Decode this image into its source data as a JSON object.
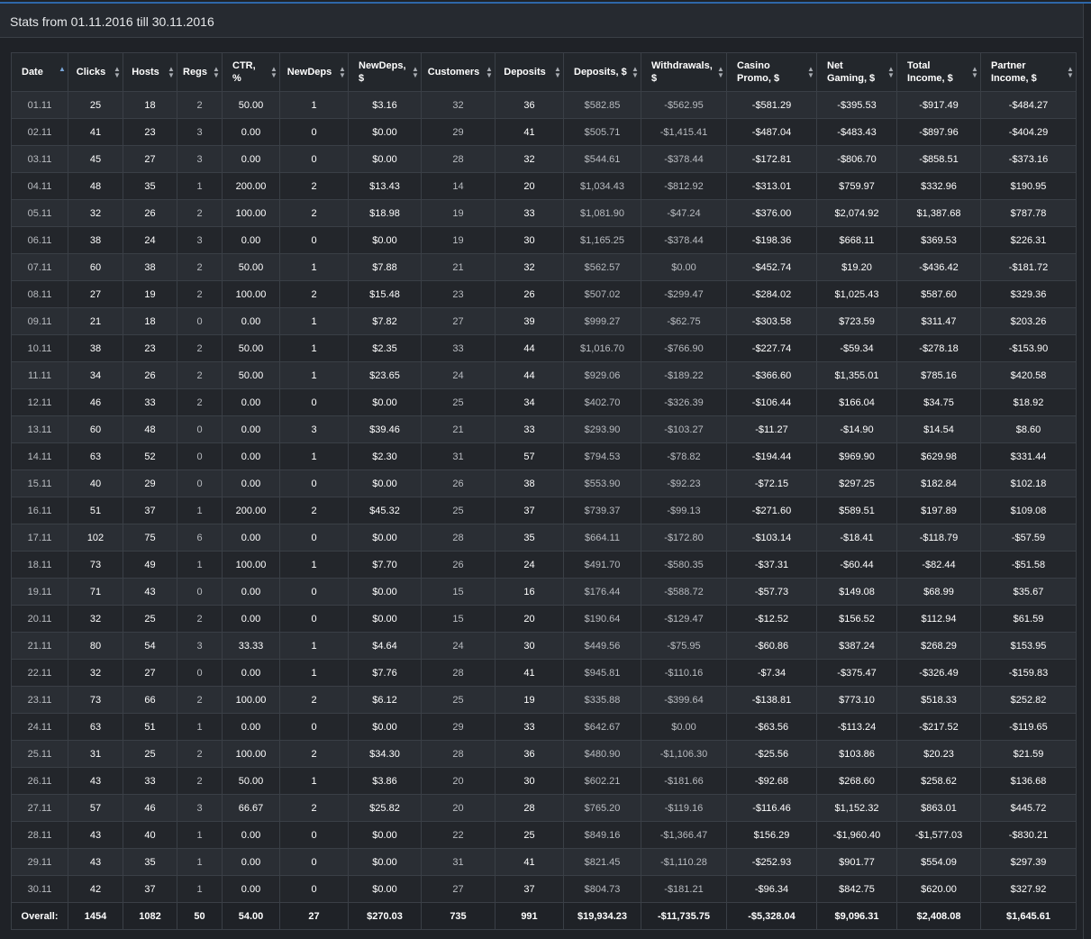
{
  "header": {
    "title": "Stats from 01.11.2016 till 30.11.2016"
  },
  "table": {
    "columns": [
      {
        "label": "Date",
        "align": "left",
        "sort": "asc"
      },
      {
        "label": "Clicks",
        "align": "center",
        "sort": "none"
      },
      {
        "label": "Hosts",
        "align": "center",
        "sort": "none"
      },
      {
        "label": "Regs",
        "align": "center",
        "sort": "none"
      },
      {
        "label": "CTR, %",
        "align": "left",
        "sort": "none"
      },
      {
        "label": "NewDeps",
        "align": "center",
        "sort": "none"
      },
      {
        "label": "NewDeps, $",
        "align": "left",
        "sort": "none"
      },
      {
        "label": "Customers",
        "align": "center",
        "sort": "none"
      },
      {
        "label": "Deposits",
        "align": "center",
        "sort": "none"
      },
      {
        "label": "Deposits, $",
        "align": "left",
        "sort": "none"
      },
      {
        "label": "Withdrawals, $",
        "align": "left",
        "sort": "none"
      },
      {
        "label": "Casino Promo, $",
        "align": "left",
        "sort": "none"
      },
      {
        "label": "Net Gaming, $",
        "align": "left",
        "sort": "none"
      },
      {
        "label": "Total Income, $",
        "align": "left",
        "sort": "none"
      },
      {
        "label": "Partner Income, $",
        "align": "left",
        "sort": "none"
      }
    ],
    "rows": [
      [
        "01.11",
        "25",
        "18",
        "2",
        "50.00",
        "1",
        "$3.16",
        "32",
        "36",
        "$582.85",
        "-$562.95",
        "-$581.29",
        "-$395.53",
        "-$917.49",
        "-$484.27"
      ],
      [
        "02.11",
        "41",
        "23",
        "3",
        "0.00",
        "0",
        "$0.00",
        "29",
        "41",
        "$505.71",
        "-$1,415.41",
        "-$487.04",
        "-$483.43",
        "-$897.96",
        "-$404.29"
      ],
      [
        "03.11",
        "45",
        "27",
        "3",
        "0.00",
        "0",
        "$0.00",
        "28",
        "32",
        "$544.61",
        "-$378.44",
        "-$172.81",
        "-$806.70",
        "-$858.51",
        "-$373.16"
      ],
      [
        "04.11",
        "48",
        "35",
        "1",
        "200.00",
        "2",
        "$13.43",
        "14",
        "20",
        "$1,034.43",
        "-$812.92",
        "-$313.01",
        "$759.97",
        "$332.96",
        "$190.95"
      ],
      [
        "05.11",
        "32",
        "26",
        "2",
        "100.00",
        "2",
        "$18.98",
        "19",
        "33",
        "$1,081.90",
        "-$47.24",
        "-$376.00",
        "$2,074.92",
        "$1,387.68",
        "$787.78"
      ],
      [
        "06.11",
        "38",
        "24",
        "3",
        "0.00",
        "0",
        "$0.00",
        "19",
        "30",
        "$1,165.25",
        "-$378.44",
        "-$198.36",
        "$668.11",
        "$369.53",
        "$226.31"
      ],
      [
        "07.11",
        "60",
        "38",
        "2",
        "50.00",
        "1",
        "$7.88",
        "21",
        "32",
        "$562.57",
        "$0.00",
        "-$452.74",
        "$19.20",
        "-$436.42",
        "-$181.72"
      ],
      [
        "08.11",
        "27",
        "19",
        "2",
        "100.00",
        "2",
        "$15.48",
        "23",
        "26",
        "$507.02",
        "-$299.47",
        "-$284.02",
        "$1,025.43",
        "$587.60",
        "$329.36"
      ],
      [
        "09.11",
        "21",
        "18",
        "0",
        "0.00",
        "1",
        "$7.82",
        "27",
        "39",
        "$999.27",
        "-$62.75",
        "-$303.58",
        "$723.59",
        "$311.47",
        "$203.26"
      ],
      [
        "10.11",
        "38",
        "23",
        "2",
        "50.00",
        "1",
        "$2.35",
        "33",
        "44",
        "$1,016.70",
        "-$766.90",
        "-$227.74",
        "-$59.34",
        "-$278.18",
        "-$153.90"
      ],
      [
        "11.11",
        "34",
        "26",
        "2",
        "50.00",
        "1",
        "$23.65",
        "24",
        "44",
        "$929.06",
        "-$189.22",
        "-$366.60",
        "$1,355.01",
        "$785.16",
        "$420.58"
      ],
      [
        "12.11",
        "46",
        "33",
        "2",
        "0.00",
        "0",
        "$0.00",
        "25",
        "34",
        "$402.70",
        "-$326.39",
        "-$106.44",
        "$166.04",
        "$34.75",
        "$18.92"
      ],
      [
        "13.11",
        "60",
        "48",
        "0",
        "0.00",
        "3",
        "$39.46",
        "21",
        "33",
        "$293.90",
        "-$103.27",
        "-$11.27",
        "-$14.90",
        "$14.54",
        "$8.60"
      ],
      [
        "14.11",
        "63",
        "52",
        "0",
        "0.00",
        "1",
        "$2.30",
        "31",
        "57",
        "$794.53",
        "-$78.82",
        "-$194.44",
        "$969.90",
        "$629.98",
        "$331.44"
      ],
      [
        "15.11",
        "40",
        "29",
        "0",
        "0.00",
        "0",
        "$0.00",
        "26",
        "38",
        "$553.90",
        "-$92.23",
        "-$72.15",
        "$297.25",
        "$182.84",
        "$102.18"
      ],
      [
        "16.11",
        "51",
        "37",
        "1",
        "200.00",
        "2",
        "$45.32",
        "25",
        "37",
        "$739.37",
        "-$99.13",
        "-$271.60",
        "$589.51",
        "$197.89",
        "$109.08"
      ],
      [
        "17.11",
        "102",
        "75",
        "6",
        "0.00",
        "0",
        "$0.00",
        "28",
        "35",
        "$664.11",
        "-$172.80",
        "-$103.14",
        "-$18.41",
        "-$118.79",
        "-$57.59"
      ],
      [
        "18.11",
        "73",
        "49",
        "1",
        "100.00",
        "1",
        "$7.70",
        "26",
        "24",
        "$491.70",
        "-$580.35",
        "-$37.31",
        "-$60.44",
        "-$82.44",
        "-$51.58"
      ],
      [
        "19.11",
        "71",
        "43",
        "0",
        "0.00",
        "0",
        "$0.00",
        "15",
        "16",
        "$176.44",
        "-$588.72",
        "-$57.73",
        "$149.08",
        "$68.99",
        "$35.67"
      ],
      [
        "20.11",
        "32",
        "25",
        "2",
        "0.00",
        "0",
        "$0.00",
        "15",
        "20",
        "$190.64",
        "-$129.47",
        "-$12.52",
        "$156.52",
        "$112.94",
        "$61.59"
      ],
      [
        "21.11",
        "80",
        "54",
        "3",
        "33.33",
        "1",
        "$4.64",
        "24",
        "30",
        "$449.56",
        "-$75.95",
        "-$60.86",
        "$387.24",
        "$268.29",
        "$153.95"
      ],
      [
        "22.11",
        "32",
        "27",
        "0",
        "0.00",
        "1",
        "$7.76",
        "28",
        "41",
        "$945.81",
        "-$110.16",
        "-$7.34",
        "-$375.47",
        "-$326.49",
        "-$159.83"
      ],
      [
        "23.11",
        "73",
        "66",
        "2",
        "100.00",
        "2",
        "$6.12",
        "25",
        "19",
        "$335.88",
        "-$399.64",
        "-$138.81",
        "$773.10",
        "$518.33",
        "$252.82"
      ],
      [
        "24.11",
        "63",
        "51",
        "1",
        "0.00",
        "0",
        "$0.00",
        "29",
        "33",
        "$642.67",
        "$0.00",
        "-$63.56",
        "-$113.24",
        "-$217.52",
        "-$119.65"
      ],
      [
        "25.11",
        "31",
        "25",
        "2",
        "100.00",
        "2",
        "$34.30",
        "28",
        "36",
        "$480.90",
        "-$1,106.30",
        "-$25.56",
        "$103.86",
        "$20.23",
        "$21.59"
      ],
      [
        "26.11",
        "43",
        "33",
        "2",
        "50.00",
        "1",
        "$3.86",
        "20",
        "30",
        "$602.21",
        "-$181.66",
        "-$92.68",
        "$268.60",
        "$258.62",
        "$136.68"
      ],
      [
        "27.11",
        "57",
        "46",
        "3",
        "66.67",
        "2",
        "$25.82",
        "20",
        "28",
        "$765.20",
        "-$119.16",
        "-$116.46",
        "$1,152.32",
        "$863.01",
        "$445.72"
      ],
      [
        "28.11",
        "43",
        "40",
        "1",
        "0.00",
        "0",
        "$0.00",
        "22",
        "25",
        "$849.16",
        "-$1,366.47",
        "$156.29",
        "-$1,960.40",
        "-$1,577.03",
        "-$830.21"
      ],
      [
        "29.11",
        "43",
        "35",
        "1",
        "0.00",
        "0",
        "$0.00",
        "31",
        "41",
        "$821.45",
        "-$1,110.28",
        "-$252.93",
        "$901.77",
        "$554.09",
        "$297.39"
      ],
      [
        "30.11",
        "42",
        "37",
        "1",
        "0.00",
        "0",
        "$0.00",
        "27",
        "37",
        "$804.73",
        "-$181.21",
        "-$96.34",
        "$842.75",
        "$620.00",
        "$327.92"
      ]
    ],
    "totals": [
      "Overall:",
      "1454",
      "1082",
      "50",
      "54.00",
      "27",
      "$270.03",
      "735",
      "991",
      "$19,934.23",
      "-$11,735.75",
      "-$5,328.04",
      "$9,096.31",
      "$2,408.08",
      "$1,645.61"
    ],
    "column_styles": [
      "dim",
      "em",
      "em",
      "dim",
      "em",
      "em",
      "em",
      "dim",
      "em",
      "dim",
      "dim",
      "em",
      "em",
      "em",
      "em"
    ]
  },
  "colors": {
    "background": "#1f2227",
    "header_bar": "#262a30",
    "accent": "#2e67a8",
    "row_odd": "#2a2e34",
    "row_even": "#23262b",
    "border": "#3a3f46"
  }
}
